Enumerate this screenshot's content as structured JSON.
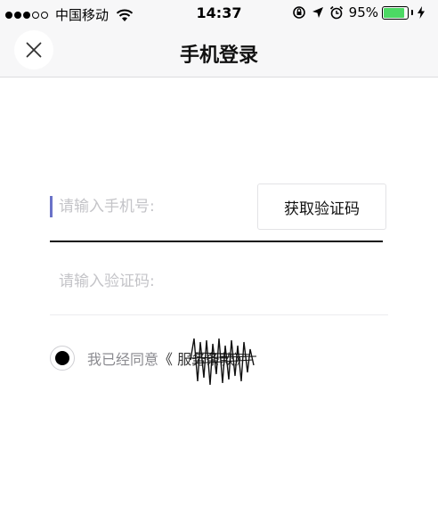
{
  "status_bar": {
    "carrier": "中国移动",
    "time": "14:37",
    "battery_percent": "95%",
    "battery_level": 0.95,
    "battery_color": "#4cd964"
  },
  "nav": {
    "title": "手机登录",
    "close_icon": "close-icon"
  },
  "form": {
    "phone_placeholder": "请输入手机号:",
    "phone_value": "",
    "get_code_label": "获取验证码",
    "code_placeholder": "请输入验证码:",
    "code_value": ""
  },
  "agreement": {
    "checked": true,
    "prefix": "我已经同意",
    "link_text": "《 服务条款》"
  },
  "colors": {
    "accent_cursor": "#6a72c8",
    "placeholder": "#c4c4c8"
  }
}
